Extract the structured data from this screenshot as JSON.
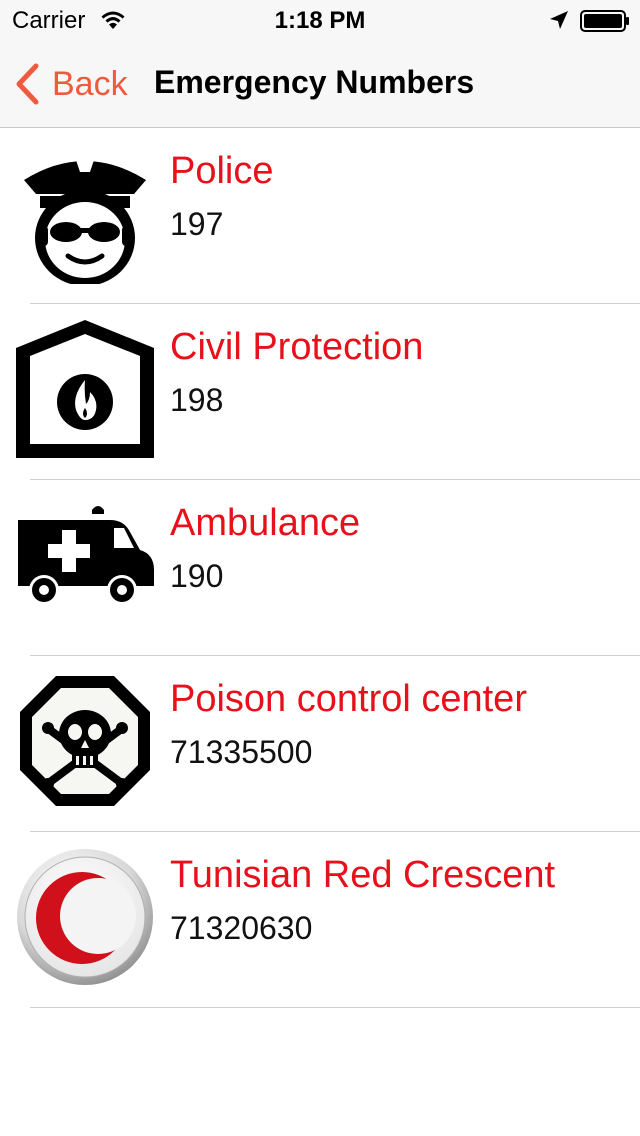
{
  "status_bar": {
    "carrier": "Carrier",
    "time": "1:18 PM",
    "icons": [
      "wifi-icon",
      "location-arrow-icon",
      "battery-icon"
    ]
  },
  "nav": {
    "back_label": "Back",
    "title": "Emergency Numbers",
    "accent_color": "#f05a3c"
  },
  "contacts": [
    {
      "name": "Police",
      "number": "197",
      "icon": "police-officer-icon"
    },
    {
      "name": "Civil Protection",
      "number": "198",
      "icon": "fire-house-icon"
    },
    {
      "name": "Ambulance",
      "number": "190",
      "icon": "ambulance-icon"
    },
    {
      "name": "Poison control center",
      "number": "71335500",
      "icon": "poison-skull-icon"
    },
    {
      "name": "Tunisian Red Crescent",
      "number": "71320630",
      "icon": "red-crescent-icon"
    }
  ],
  "colors": {
    "name_text": "#e8101a",
    "number_text": "#111111",
    "separator": "#d0d0d4"
  }
}
